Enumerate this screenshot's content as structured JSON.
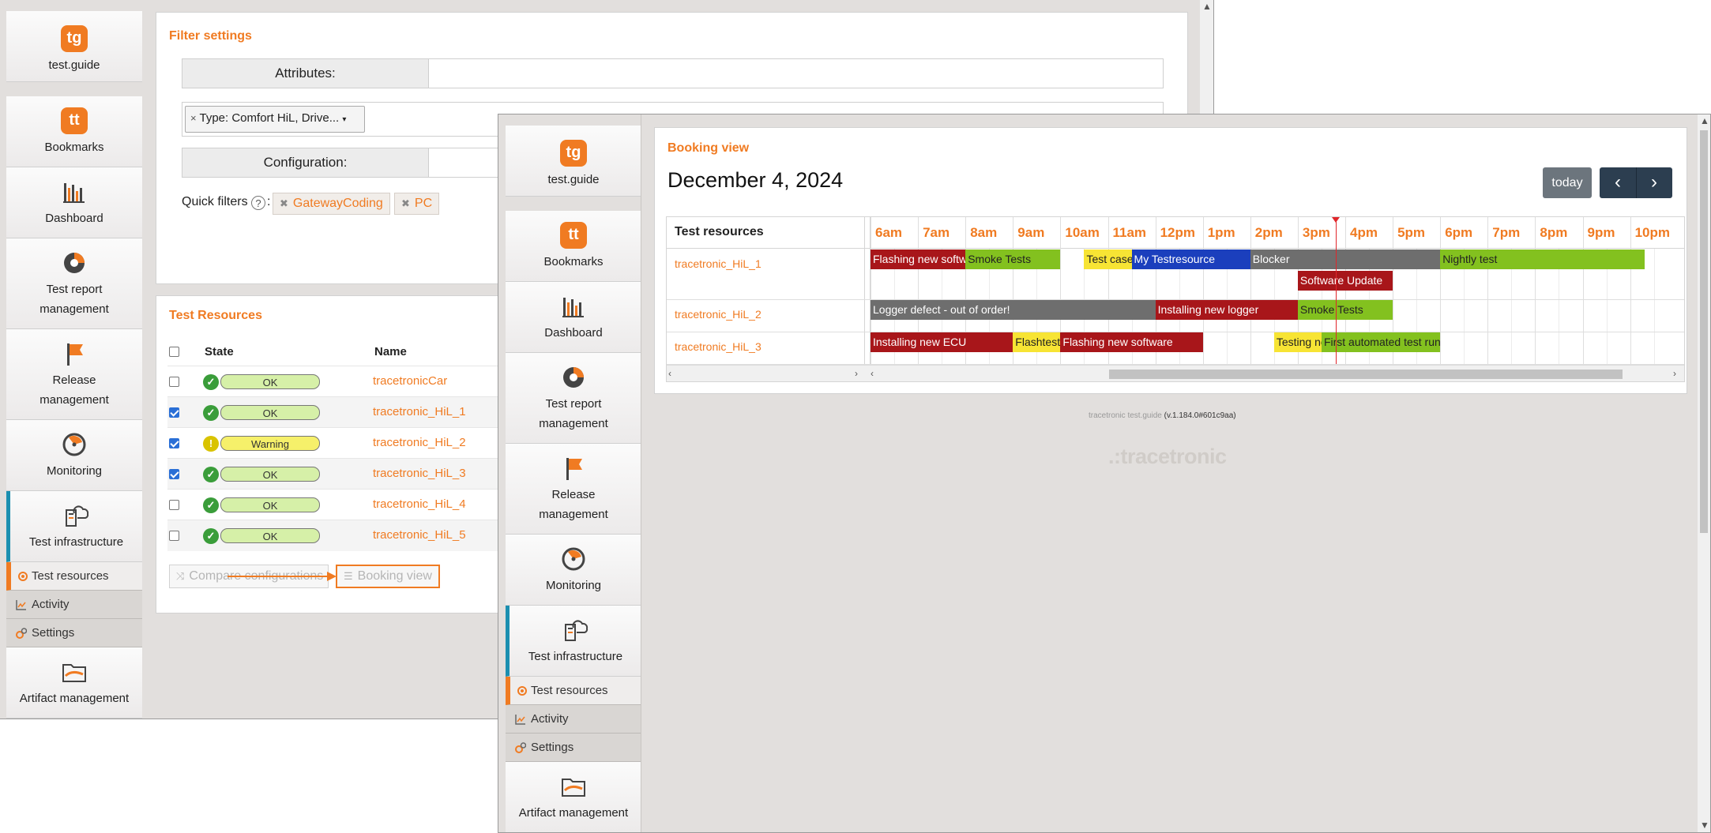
{
  "nav": {
    "logo_label": "test.guide",
    "logo_badge": "tg",
    "bookmarks_badge": "tt",
    "items": [
      {
        "label": "Bookmarks"
      },
      {
        "label": "Dashboard"
      },
      {
        "label": "Test report management"
      },
      {
        "label": "Release management"
      },
      {
        "label": "Monitoring"
      },
      {
        "label": "Test infrastructure"
      }
    ],
    "subitems": [
      {
        "label": "Test resources"
      },
      {
        "label": "Activity"
      },
      {
        "label": "Settings"
      }
    ],
    "artifact_label": "Artifact management"
  },
  "filter": {
    "title": "Filter settings",
    "attributes_label": "Attributes:",
    "type_tag": "Type: Comfort HiL, Drive...",
    "configuration_label": "Configuration:",
    "quick_filters_label": "Quick filters",
    "quick_filters": [
      "GatewayCoding",
      "PC"
    ]
  },
  "resources": {
    "title": "Test Resources",
    "col_state": "State",
    "col_name": "Name",
    "rows": [
      {
        "checked": false,
        "state": "OK",
        "name": "tracetronicCar"
      },
      {
        "checked": true,
        "state": "OK",
        "name": "tracetronic_HiL_1"
      },
      {
        "checked": true,
        "state": "Warning",
        "name": "tracetronic_HiL_2"
      },
      {
        "checked": true,
        "state": "OK",
        "name": "tracetronic_HiL_3"
      },
      {
        "checked": false,
        "state": "OK",
        "name": "tracetronic_HiL_4"
      },
      {
        "checked": false,
        "state": "OK",
        "name": "tracetronic_HiL_5"
      }
    ],
    "compare_button": "Compare configurations",
    "booking_button": "Booking view"
  },
  "booking": {
    "title": "Booking view",
    "date": "December 4, 2024",
    "today_button": "today",
    "column_header": "Test resources",
    "hours": [
      "6am",
      "7am",
      "8am",
      "9am",
      "10am",
      "11am",
      "12pm",
      "1pm",
      "2pm",
      "3pm",
      "4pm",
      "5pm",
      "6pm",
      "7pm",
      "8pm",
      "9pm",
      "10pm"
    ],
    "resources": [
      "tracetronic_HiL_1",
      "tracetronic_HiL_2",
      "tracetronic_HiL_3"
    ],
    "bookings": [
      {
        "label": "Flashing new software",
        "start": 6,
        "end": 8,
        "lane": 0,
        "sub": 0,
        "color": "#a8161a"
      },
      {
        "label": "Smoke Tests",
        "start": 8,
        "end": 10,
        "lane": 0,
        "sub": 0,
        "color": "#83c11f"
      },
      {
        "label": "Test case",
        "start": 10.5,
        "end": 11.5,
        "lane": 0,
        "sub": 0,
        "color": "#f7e434"
      },
      {
        "label": "My Testresource",
        "start": 11.5,
        "end": 14,
        "lane": 0,
        "sub": 0,
        "color": "#1b3fbd"
      },
      {
        "label": "Blocker",
        "start": 14,
        "end": 18,
        "lane": 0,
        "sub": 0,
        "color": "#6e6e6e"
      },
      {
        "label": "Nightly test",
        "start": 18,
        "end": 22.3,
        "lane": 0,
        "sub": 0,
        "color": "#83c11f"
      },
      {
        "label": "Software Update",
        "start": 15,
        "end": 17,
        "lane": 0,
        "sub": 1,
        "color": "#a8161a"
      },
      {
        "label": "Logger defect - out of order!",
        "start": 6,
        "end": 12,
        "lane": 1,
        "sub": 0,
        "color": "#6e6e6e"
      },
      {
        "label": "Installing new logger",
        "start": 12,
        "end": 15,
        "lane": 1,
        "sub": 0,
        "color": "#a8161a"
      },
      {
        "label": "Smoke Tests",
        "start": 15,
        "end": 17,
        "lane": 1,
        "sub": 0,
        "color": "#83c11f"
      },
      {
        "label": "Installing new ECU",
        "start": 6,
        "end": 9,
        "lane": 2,
        "sub": 0,
        "color": "#a8161a"
      },
      {
        "label": "Flashtest",
        "start": 9,
        "end": 10,
        "lane": 2,
        "sub": 0,
        "color": "#f7e434"
      },
      {
        "label": "Flashing new software",
        "start": 10,
        "end": 13,
        "lane": 2,
        "sub": 0,
        "color": "#a8161a"
      },
      {
        "label": "Testing new",
        "start": 14.5,
        "end": 15.5,
        "lane": 2,
        "sub": 0,
        "color": "#f7e434"
      },
      {
        "label": "First automated test run",
        "start": 15.5,
        "end": 18,
        "lane": 2,
        "sub": 0,
        "color": "#83c11f"
      }
    ],
    "now_hour": 15.8
  },
  "footer": {
    "version_prefix": "tracetronic test.guide",
    "version": "(v.1.184.0#601c9aa)",
    "brand": "tracetronic"
  },
  "colors": {
    "accent": "#f07b22",
    "active_nav": "#1b8fb0"
  }
}
